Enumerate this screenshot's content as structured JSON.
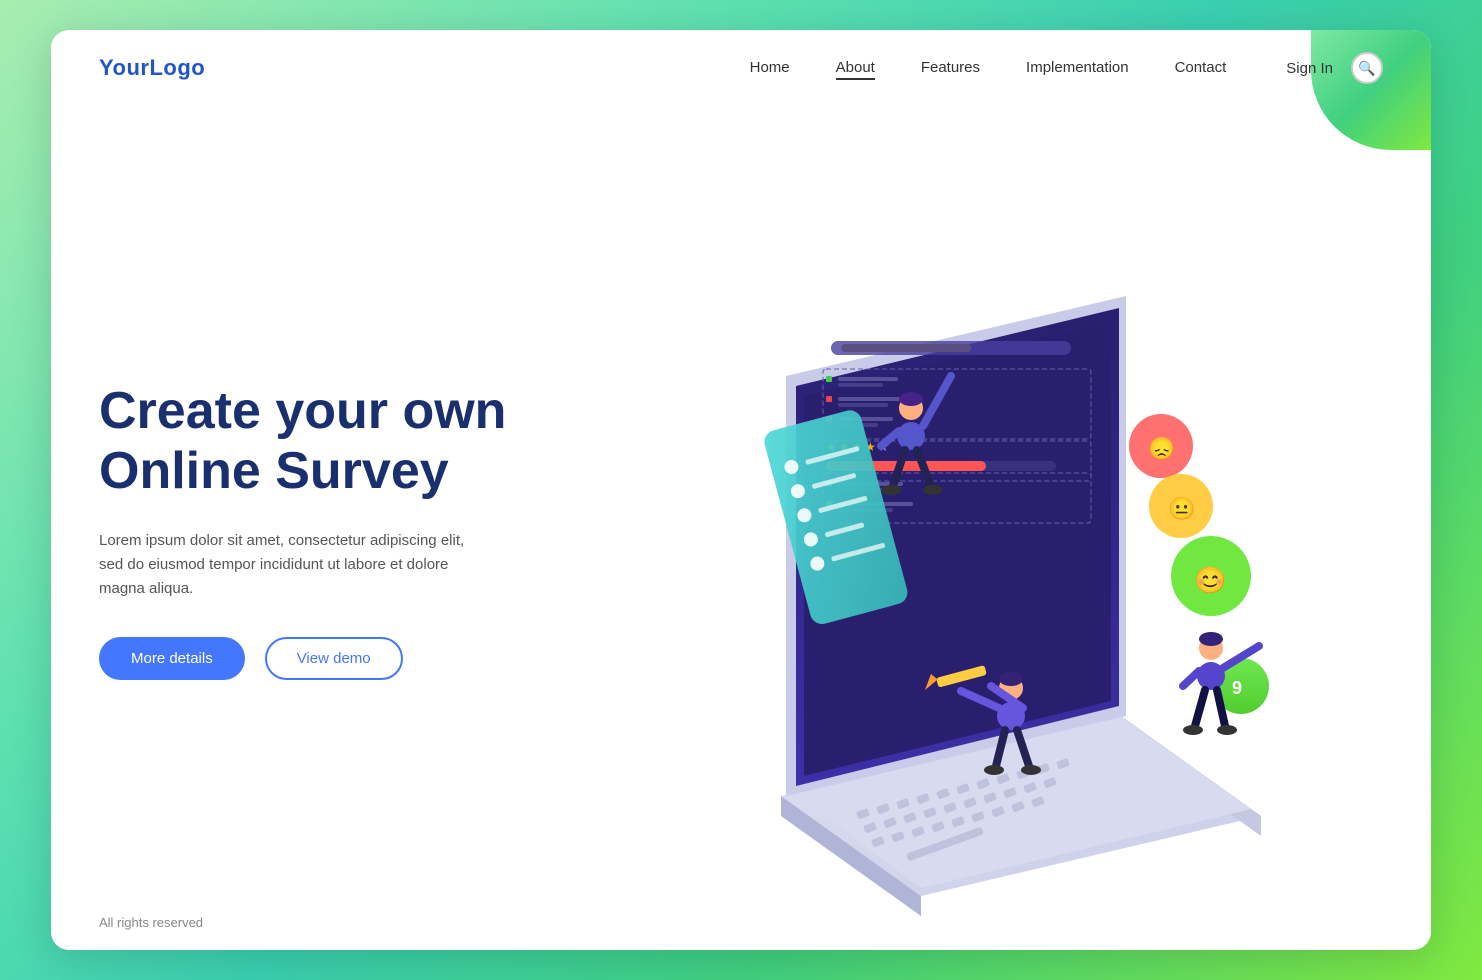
{
  "logo": "YourLogo",
  "nav": {
    "links": [
      {
        "label": "Home",
        "active": false
      },
      {
        "label": "About",
        "active": true
      },
      {
        "label": "Features",
        "active": false
      },
      {
        "label": "Implementation",
        "active": false
      },
      {
        "label": "Contact",
        "active": false
      }
    ],
    "signin": "Sign In",
    "search_aria": "Search"
  },
  "hero": {
    "title": "Create your own\nOnline Survey",
    "description": "Lorem ipsum dolor sit amet, consectetur adipiscing elit,\nsed do eiusmod tempor incididunt ut labore et dolore\nmagna aliqua.",
    "btn_primary": "More details",
    "btn_secondary": "View demo"
  },
  "footer": {
    "text": "All rights reserved"
  },
  "illustration": {
    "badge_number": "9"
  }
}
